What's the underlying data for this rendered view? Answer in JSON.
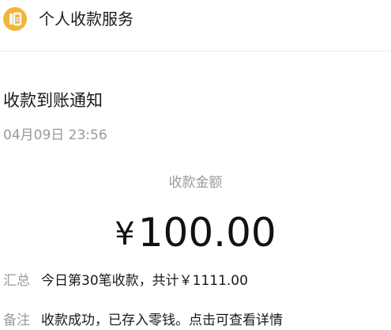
{
  "header": {
    "service_name": "个人收款服务",
    "icon": "payment-service-icon",
    "icon_color": "#f4b43a"
  },
  "notice": {
    "title": "收款到账通知",
    "datetime": "04月09日 23:56",
    "amount_label": "收款金额",
    "currency_symbol": "¥",
    "amount": "100.00"
  },
  "details": {
    "summary_label": "汇总",
    "summary_value": "今日第30笔收款，共计￥1111.00",
    "note_label": "备注",
    "note_value": "收款成功，已存入零钱。点击可查看详情"
  }
}
